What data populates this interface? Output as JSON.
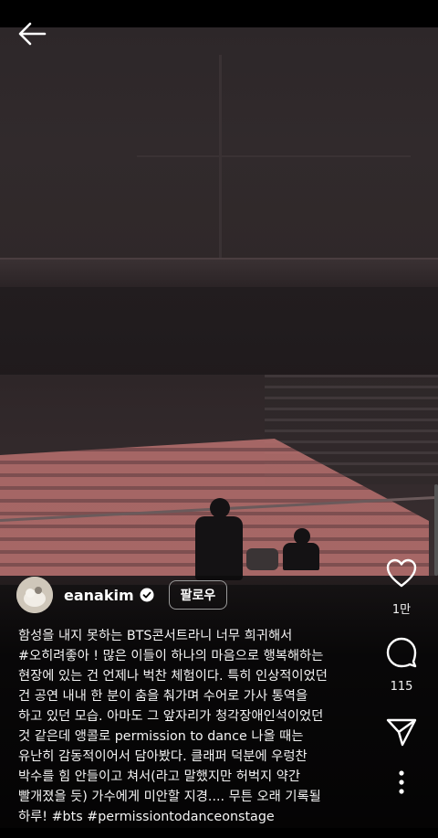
{
  "post": {
    "username": "eanakim",
    "follow_label": "팔로우",
    "like_count": "1만",
    "comment_count": "115"
  },
  "caption": {
    "lines": [
      "함성을 내지 못하는 BTS콘서트라니 너무 희귀해서",
      "#오히려좋아 ! 많은 이들이 하나의 마음으로 행복해하는",
      "현장에 있는 건 언제나 벅찬 체험이다. 특히 인상적이었던",
      "건 공연 내내 한 분이 춤을 춰가며 수어로 가사 통역을",
      "하고 있던 모습. 아마도 그 앞자리가 청각장애인석이었던",
      "것 같은데 앵콜로 permission to dance 나올 때는",
      "유난히 감동적이어서 담아봤다.  클래퍼 덕분에 우렁찬",
      "박수를 힘 안들이고 쳐서(라고 말했지만 허벅지 약간",
      "빨개졌을 듯) 가수에게 미안할 지경.... 무튼 오래 기록될",
      "하루! #bts #permissiontodanceonstage"
    ]
  },
  "icons": {
    "back": "arrow-left-icon",
    "verified": "verified-badge-icon",
    "like": "heart-icon",
    "comment": "comment-bubble-icon",
    "share": "send-paper-plane-icon",
    "more": "more-vertical-icon"
  },
  "colors": {
    "text": "#ffffff",
    "seats": "#b9716f",
    "background": "#000000"
  }
}
